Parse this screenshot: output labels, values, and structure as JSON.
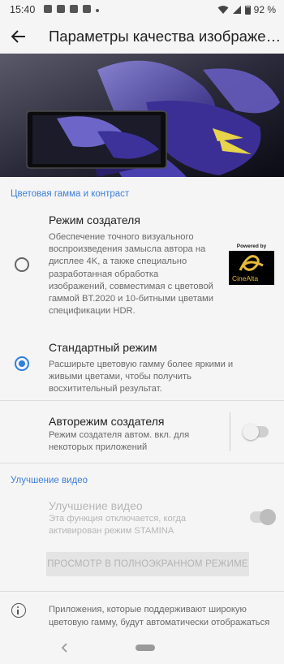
{
  "status_bar": {
    "time": "15:40",
    "battery_percent": "92 %",
    "battery_level": 0.92
  },
  "app_bar": {
    "title": "Параметры качества изображе…"
  },
  "sections": {
    "color_gamut": {
      "header": "Цветовая гамма и контраст",
      "creator_mode": {
        "title": "Режим создателя",
        "description": "Обеспечение точного визуального воспроизведения замысла автора на дисплее 4K, а также специально разработанная обработка изображений, совместимая с цветовой гаммой BT.2020 и 10-битными цветами спецификации HDR.",
        "selected": false,
        "badge_powered": "Powered by",
        "badge_brand": "CineAlta"
      },
      "standard_mode": {
        "title": "Стандартный режим",
        "description": "Расширьте цветовую гамму более яркими и живыми цветами, чтобы получить восхитительный результат.",
        "selected": true
      },
      "auto_creator_mode": {
        "title": "Авторежим создателя",
        "description": "Режим создателя автом. вкл. для некоторых приложений",
        "enabled": false
      }
    },
    "video_enhancement": {
      "header": "Улучшение видео",
      "enhance": {
        "title": "Улучшение видео",
        "description": "Эта функция отключается, когда активирован режим STAMINA",
        "enabled": true,
        "disabled_state": true
      },
      "fullscreen_button": "ПРОСМОТР В ПОЛНОЭКРАННОМ РЕЖИМЕ"
    }
  },
  "info": {
    "text": "Приложения, которые поддерживают широкую цветовую гамму, будут автоматически отображаться в оригинальных цветах"
  },
  "colors": {
    "accent": "#2f7fe0",
    "section_header": "#3d7fdc",
    "disabled_text": "#b6b6b6"
  }
}
